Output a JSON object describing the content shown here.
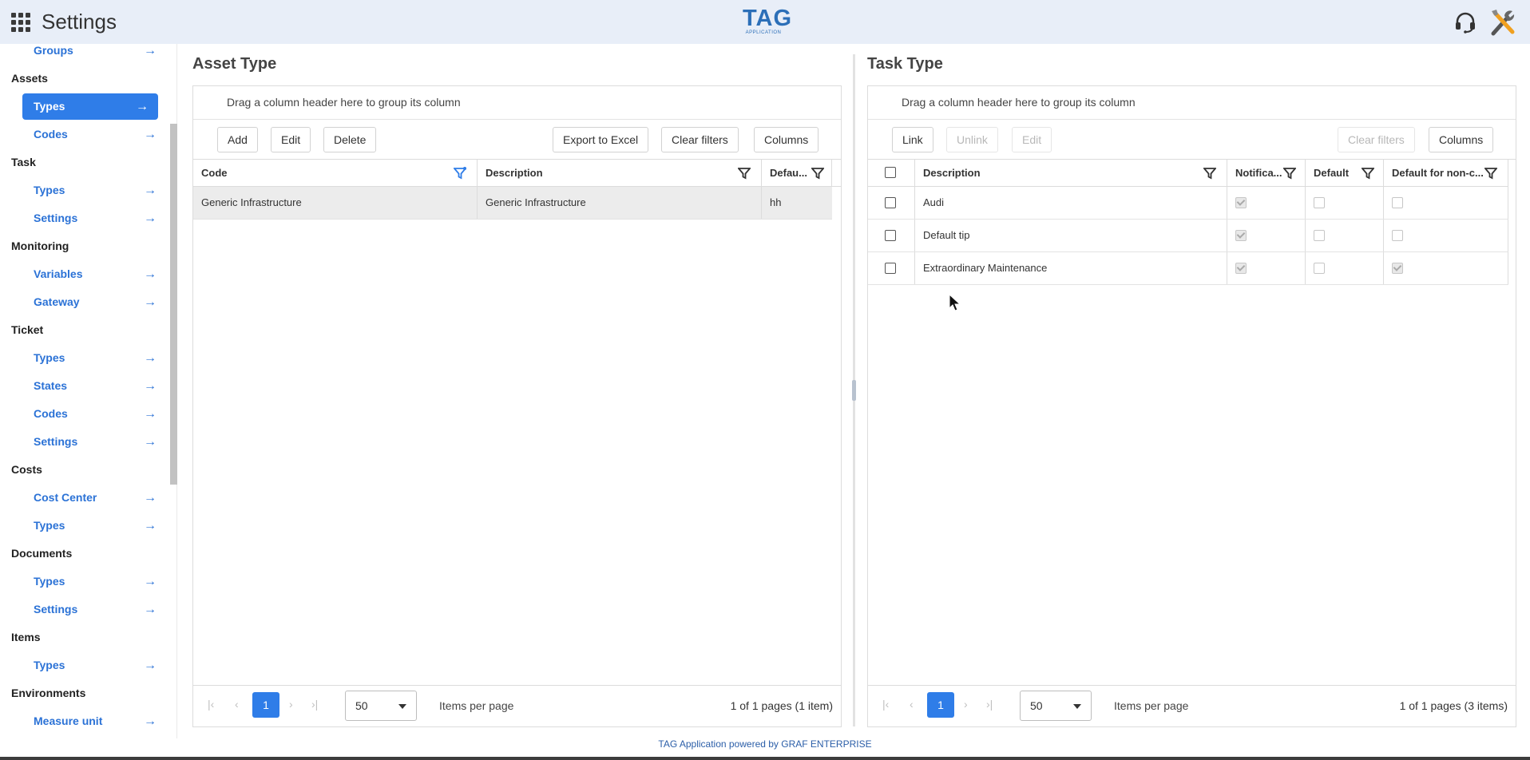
{
  "header": {
    "title": "Settings",
    "logo_main": "TAG",
    "logo_sub": "APPLICATION",
    "icons": [
      "apps-grid-icon",
      "headset-support-icon",
      "tools-icon"
    ]
  },
  "sidebar": {
    "entries": [
      {
        "kind": "item",
        "label": "Groups",
        "name": "sidebar-item-groups"
      },
      {
        "kind": "section",
        "label": "Assets"
      },
      {
        "kind": "item",
        "label": "Types",
        "name": "sidebar-item-asset-types",
        "active": true
      },
      {
        "kind": "item",
        "label": "Codes",
        "name": "sidebar-item-asset-codes"
      },
      {
        "kind": "section",
        "label": "Task"
      },
      {
        "kind": "item",
        "label": "Types",
        "name": "sidebar-item-task-types"
      },
      {
        "kind": "item",
        "label": "Settings",
        "name": "sidebar-item-task-settings"
      },
      {
        "kind": "section",
        "label": "Monitoring"
      },
      {
        "kind": "item",
        "label": "Variables",
        "name": "sidebar-item-variables"
      },
      {
        "kind": "item",
        "label": "Gateway",
        "name": "sidebar-item-gateway"
      },
      {
        "kind": "section",
        "label": "Ticket"
      },
      {
        "kind": "item",
        "label": "Types",
        "name": "sidebar-item-ticket-types"
      },
      {
        "kind": "item",
        "label": "States",
        "name": "sidebar-item-ticket-states"
      },
      {
        "kind": "item",
        "label": "Codes",
        "name": "sidebar-item-ticket-codes"
      },
      {
        "kind": "item",
        "label": "Settings",
        "name": "sidebar-item-ticket-settings"
      },
      {
        "kind": "section",
        "label": "Costs"
      },
      {
        "kind": "item",
        "label": "Cost Center",
        "name": "sidebar-item-cost-center"
      },
      {
        "kind": "item",
        "label": "Types",
        "name": "sidebar-item-cost-types"
      },
      {
        "kind": "section",
        "label": "Documents"
      },
      {
        "kind": "item",
        "label": "Types",
        "name": "sidebar-item-document-types"
      },
      {
        "kind": "item",
        "label": "Settings",
        "name": "sidebar-item-document-settings"
      },
      {
        "kind": "section",
        "label": "Items"
      },
      {
        "kind": "item",
        "label": "Types",
        "name": "sidebar-item-item-types"
      },
      {
        "kind": "section",
        "label": "Environments"
      },
      {
        "kind": "item",
        "label": "Measure unit",
        "name": "sidebar-item-measure-unit"
      }
    ],
    "arrow": "→"
  },
  "asset_panel": {
    "title": "Asset Type",
    "group_hint": "Drag a column header here to group its column",
    "buttons": {
      "add": "Add",
      "edit": "Edit",
      "delete": "Delete",
      "export": "Export to Excel",
      "clear_filters": "Clear filters",
      "columns": "Columns"
    },
    "columns": {
      "code": "Code",
      "description": "Description",
      "default": "Defau..."
    },
    "rows": [
      {
        "code": "Generic Infrastructure",
        "description": "Generic Infrastructure",
        "default": "hh"
      }
    ],
    "pager": {
      "page": "1",
      "page_size": "50",
      "items_per_page": "Items per page",
      "info": "1 of 1 pages (1 item)"
    }
  },
  "task_panel": {
    "title": "Task Type",
    "group_hint": "Drag a column header here to group its column",
    "buttons": {
      "link": "Link",
      "unlink": "Unlink",
      "edit": "Edit",
      "clear_filters": "Clear filters",
      "columns": "Columns"
    },
    "columns": {
      "description": "Description",
      "notification": "Notifica...",
      "default": "Default",
      "default_non": "Default for non-c..."
    },
    "rows": [
      {
        "description": "Audi",
        "notification": true,
        "default": false,
        "default_non": false
      },
      {
        "description": "Default tip",
        "notification": true,
        "default": false,
        "default_non": false
      },
      {
        "description": "Extraordinary Maintenance",
        "notification": true,
        "default": false,
        "default_non": true
      }
    ],
    "pager": {
      "page": "1",
      "page_size": "50",
      "items_per_page": "Items per page",
      "info": "1 of 1 pages (3 items)"
    }
  },
  "footer": {
    "text": "TAG Application powered by GRAF ENTERPRISE"
  },
  "colors": {
    "accent": "#2f7de8",
    "link": "#2b72d6",
    "topbar": "#e8eef8"
  }
}
